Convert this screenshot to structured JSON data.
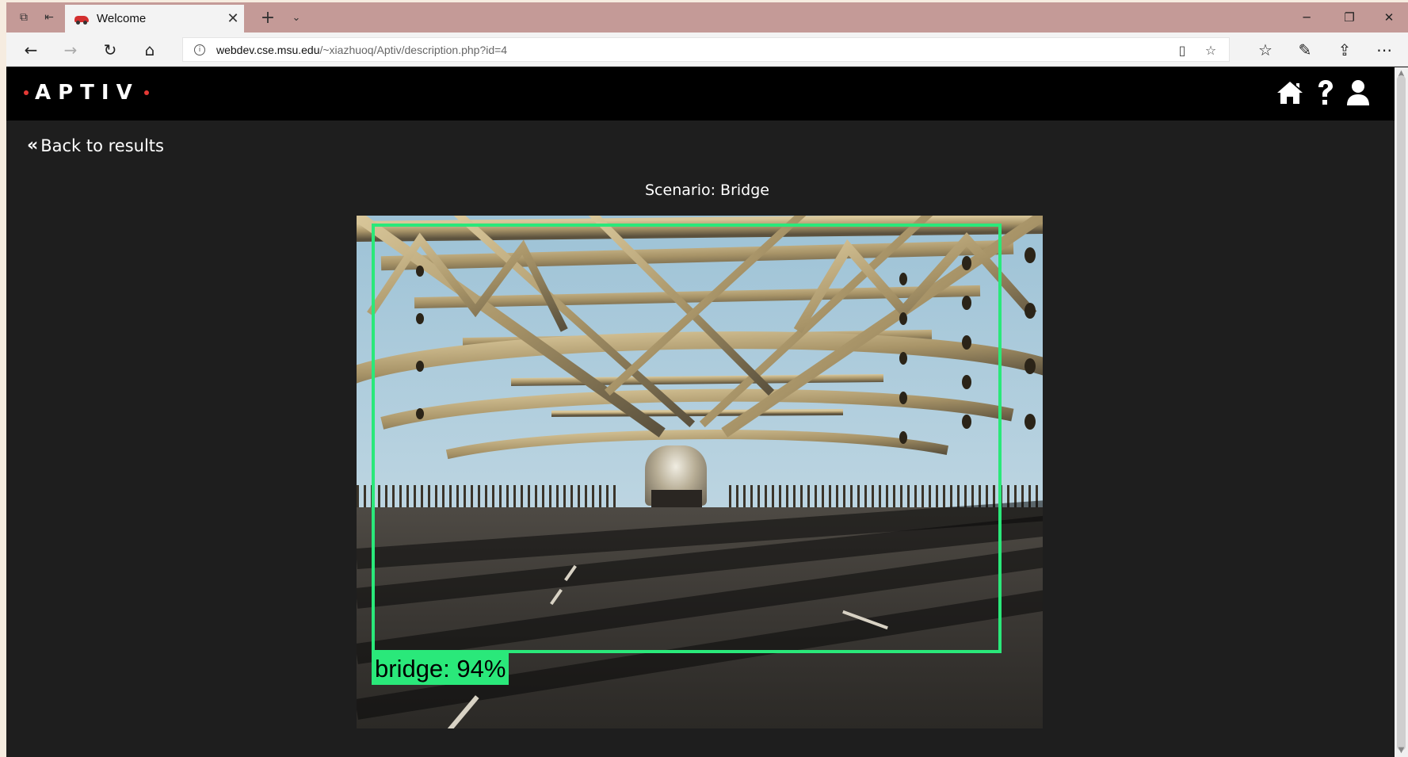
{
  "browser": {
    "tab": {
      "title": "Welcome"
    },
    "address": {
      "host": "webdev.cse.msu.edu",
      "path": "/~xiazhuoq/Aptiv/description.php?id=4"
    }
  },
  "site": {
    "logo_text": "APTIV",
    "back_link": "Back to results",
    "scenario": "Scenario: Bridge",
    "detection_label": "bridge: 94%",
    "colors": {
      "detection_box": "#2ae87a",
      "header_bg": "#000000",
      "page_bg": "#1e1e1e",
      "logo_dot": "#e53935"
    },
    "icons": [
      "home-icon",
      "help-icon",
      "user-icon"
    ]
  }
}
